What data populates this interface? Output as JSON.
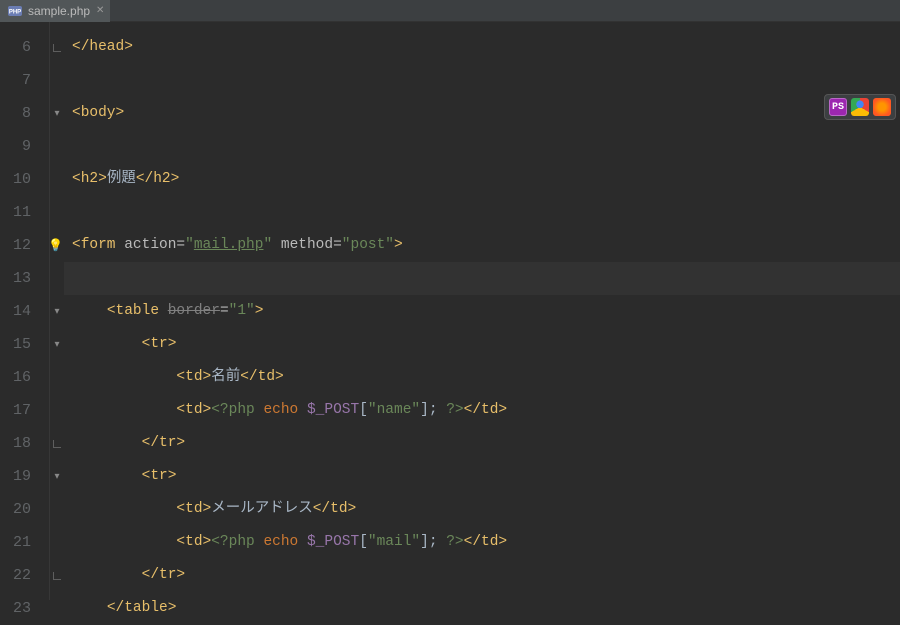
{
  "tab": {
    "filename": "sample.php"
  },
  "toolbar": {
    "ide": "PS"
  },
  "gutter": {
    "start": 6,
    "end": 23
  },
  "code": {
    "l6": {
      "tag_close_head": "</head>"
    },
    "l8": {
      "tag_body": "<body>"
    },
    "l10": {
      "h2_open": "<h2>",
      "h2_text": "例題",
      "h2_close": "</h2>"
    },
    "l12": {
      "form_open": "<form",
      "attr_action": " action=",
      "q1": "\"",
      "action_val": "mail.php",
      "q2": "\"",
      "attr_method": " method=",
      "method_val": "\"post\"",
      "form_close": ">"
    },
    "l14": {
      "table_open": "<table",
      "sp": " ",
      "border_attr": "border",
      "eq": "=",
      "border_val": "\"1\"",
      "table_close": ">"
    },
    "l15": {
      "tr_open": "<tr>"
    },
    "l16": {
      "td_open": "<td>",
      "td_text": "名前",
      "td_close": "</td>"
    },
    "l17": {
      "td_open": "<td>",
      "php_open": "<?php",
      "sp1": " ",
      "echo": "echo",
      "sp2": " ",
      "post": "$_POST",
      "br_open": "[",
      "key": "\"name\"",
      "br_close": "]",
      "semi": "; ",
      "php_close": "?>",
      "td_close": "</td>"
    },
    "l18": {
      "tr_close": "</tr>"
    },
    "l19": {
      "tr_open": "<tr>"
    },
    "l20": {
      "td_open": "<td>",
      "td_text": "メールアドレス",
      "td_close": "</td>"
    },
    "l21": {
      "td_open": "<td>",
      "php_open": "<?php",
      "sp1": " ",
      "echo": "echo",
      "sp2": " ",
      "post": "$_POST",
      "br_open": "[",
      "key": "\"mail\"",
      "br_close": "]",
      "semi": "; ",
      "php_close": "?>",
      "td_close": "</td>"
    },
    "l22": {
      "tr_close": "</tr>"
    },
    "l23": {
      "table_close": "</table>"
    }
  }
}
